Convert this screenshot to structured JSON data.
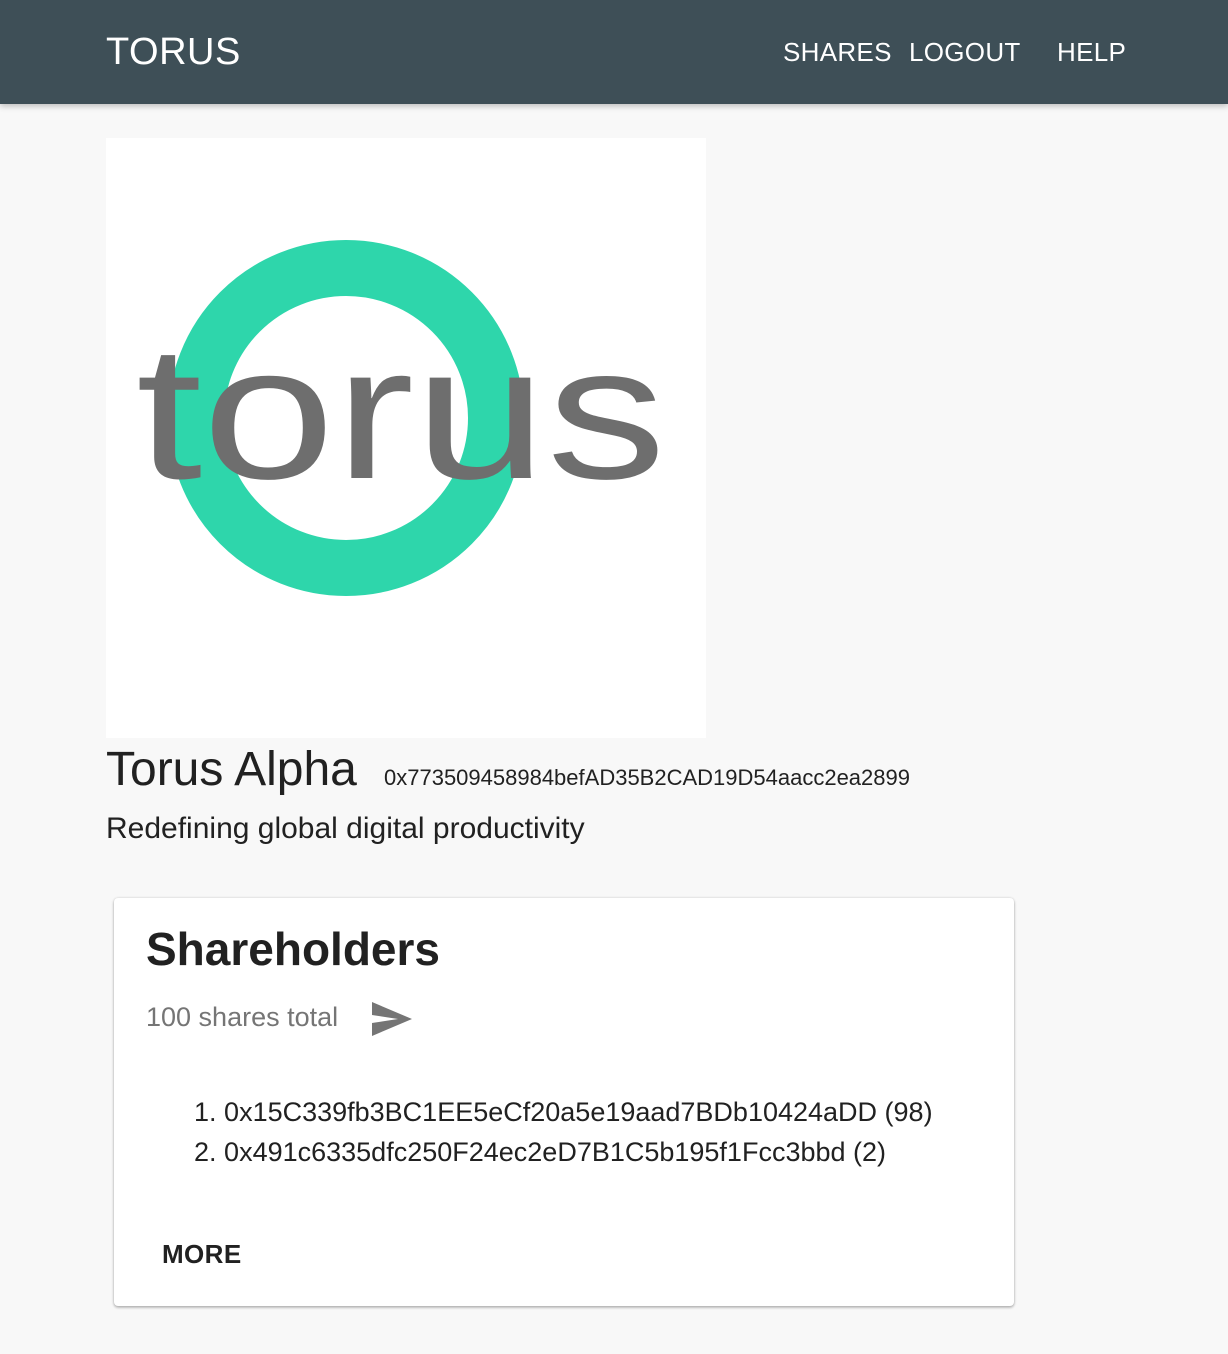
{
  "header": {
    "brand": "TORUS",
    "nav": {
      "shares": "SHARES",
      "logout": "LOGOUT",
      "help": "HELP"
    },
    "background_color": "#3e4f57"
  },
  "company": {
    "logo_text": "torus",
    "logo_ring_color": "#2ed6ab",
    "logo_text_color": "#6e6e6e",
    "name": "Torus Alpha",
    "address": "0x773509458984befAD35B2CAD19D54aacc2ea2899",
    "tagline": "Redefining global digital productivity"
  },
  "shareholders_card": {
    "title": "Shareholders",
    "shares_total": "100 shares total",
    "send_icon": "send-icon",
    "holders": [
      {
        "index": "1.",
        "entry": "0x15C339fb3BC1EE5eCf20a5e19aad7BDb10424aDD (98)"
      },
      {
        "index": "2.",
        "entry": "0x491c6335dfc250F24ec2eD7B1C5b195f1Fcc3bbd (2)"
      }
    ],
    "more_label": "MORE"
  }
}
